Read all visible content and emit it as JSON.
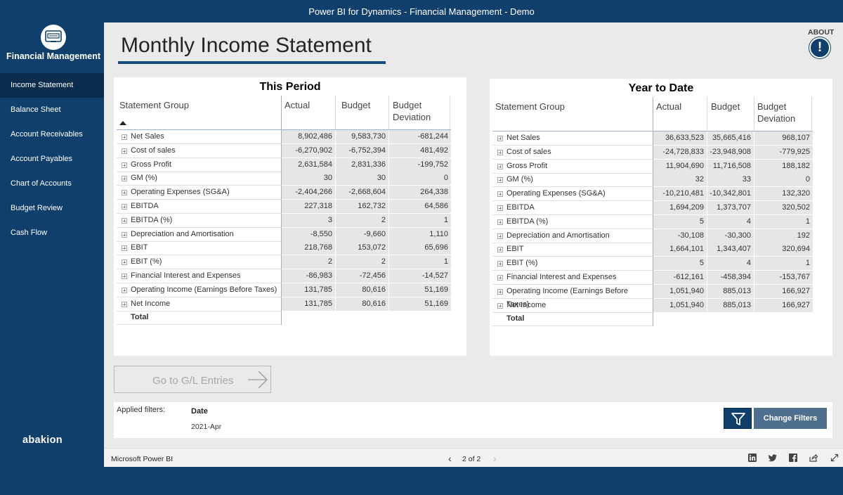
{
  "app": {
    "window_title": "Power BI for Dynamics - Financial Management - Demo"
  },
  "sidebar": {
    "app_title": "Financial Management",
    "brand": "abakion",
    "items": [
      {
        "label": "Income Statement",
        "active": true
      },
      {
        "label": "Balance Sheet",
        "active": false
      },
      {
        "label": "Account Receivables",
        "active": false
      },
      {
        "label": "Account Payables",
        "active": false
      },
      {
        "label": "Chart of Accounts",
        "active": false
      },
      {
        "label": "Budget Review",
        "active": false
      },
      {
        "label": "Cash Flow",
        "active": false
      }
    ]
  },
  "page": {
    "title": "Monthly Income Statement",
    "about_label": "ABOUT",
    "about_icon": "!"
  },
  "this_period": {
    "title": "This Period",
    "columns": [
      "Statement Group",
      "Actual",
      "Budget",
      "Budget Deviation"
    ],
    "rows": [
      {
        "group": "Net Sales",
        "actual": "8,902,486",
        "budget": "9,583,730",
        "deviation": "-681,244"
      },
      {
        "group": "Cost of sales",
        "actual": "-6,270,902",
        "budget": "-6,752,394",
        "deviation": "481,492"
      },
      {
        "group": "Gross Profit",
        "actual": "2,631,584",
        "budget": "2,831,336",
        "deviation": "-199,752"
      },
      {
        "group": "GM (%)",
        "actual": "30",
        "budget": "30",
        "deviation": "0"
      },
      {
        "group": "Operating Expenses (SG&A)",
        "actual": "-2,404,266",
        "budget": "-2,668,604",
        "deviation": "264,338"
      },
      {
        "group": "EBITDA",
        "actual": "227,318",
        "budget": "162,732",
        "deviation": "64,586"
      },
      {
        "group": "EBITDA (%)",
        "actual": "3",
        "budget": "2",
        "deviation": "1"
      },
      {
        "group": "Depreciation and Amortisation",
        "actual": "-8,550",
        "budget": "-9,660",
        "deviation": "1,110"
      },
      {
        "group": "EBIT",
        "actual": "218,768",
        "budget": "153,072",
        "deviation": "65,696"
      },
      {
        "group": "EBIT (%)",
        "actual": "2",
        "budget": "2",
        "deviation": "1"
      },
      {
        "group": "Financial Interest and Expenses",
        "actual": "-86,983",
        "budget": "-72,456",
        "deviation": "-14,527"
      },
      {
        "group": "Operating Income (Earnings Before Taxes)",
        "actual": "131,785",
        "budget": "80,616",
        "deviation": "51,169"
      },
      {
        "group": "Net Income",
        "actual": "131,785",
        "budget": "80,616",
        "deviation": "51,169"
      }
    ],
    "total_label": "Total"
  },
  "year_to_date": {
    "title": "Year to Date",
    "columns": [
      "Statement Group",
      "Actual",
      "Budget",
      "Budget Deviation"
    ],
    "rows": [
      {
        "group": "Net Sales",
        "actual": "36,633,523",
        "budget": "35,665,416",
        "deviation": "968,107"
      },
      {
        "group": "Cost of sales",
        "actual": "-24,728,833",
        "budget": "-23,948,908",
        "deviation": "-779,925"
      },
      {
        "group": "Gross Profit",
        "actual": "11,904,690",
        "budget": "11,716,508",
        "deviation": "188,182"
      },
      {
        "group": "GM (%)",
        "actual": "32",
        "budget": "33",
        "deviation": "0"
      },
      {
        "group": "Operating Expenses (SG&A)",
        "actual": "-10,210,481",
        "budget": "-10,342,801",
        "deviation": "132,320"
      },
      {
        "group": "EBITDA",
        "actual": "1,694,209",
        "budget": "1,373,707",
        "deviation": "320,502"
      },
      {
        "group": "EBITDA (%)",
        "actual": "5",
        "budget": "4",
        "deviation": "1"
      },
      {
        "group": "Depreciation and Amortisation",
        "actual": "-30,108",
        "budget": "-30,300",
        "deviation": "192"
      },
      {
        "group": "EBIT",
        "actual": "1,664,101",
        "budget": "1,343,407",
        "deviation": "320,694"
      },
      {
        "group": "EBIT (%)",
        "actual": "5",
        "budget": "4",
        "deviation": "1"
      },
      {
        "group": "Financial Interest and Expenses",
        "actual": "-612,161",
        "budget": "-458,394",
        "deviation": "-153,767"
      },
      {
        "group": "Operating Income (Earnings Before Taxes)",
        "actual": "1,051,940",
        "budget": "885,013",
        "deviation": "166,927"
      },
      {
        "group": "Net Income",
        "actual": "1,051,940",
        "budget": "885,013",
        "deviation": "166,927"
      }
    ],
    "total_label": "Total"
  },
  "actions": {
    "goto_label": "Go to G/L Entries",
    "change_filters_label": "Change Filters"
  },
  "filters": {
    "applied_label": "Applied filters:",
    "name": "Date",
    "value": "2021-Apr"
  },
  "footer": {
    "product": "Microsoft Power BI",
    "page_indicator": "2 of 2"
  },
  "colors": {
    "navy": "#0f3f6a",
    "canvas": "#eaeaea",
    "accent_underline": "#1a4e80",
    "change_filters_button": "#4f6f8f"
  }
}
